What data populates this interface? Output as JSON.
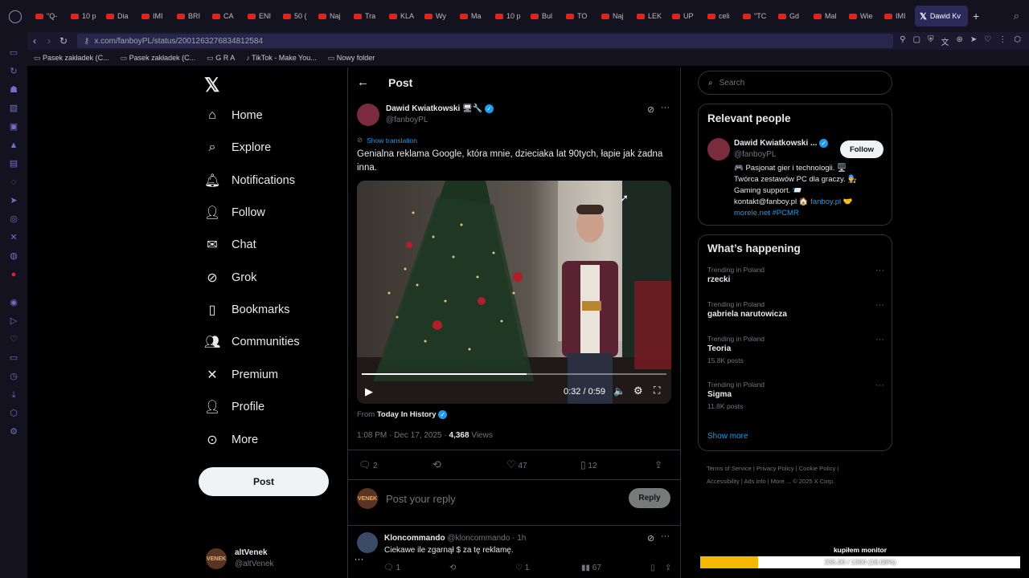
{
  "browser": {
    "tabs": [
      {
        "label": "\"Q-"
      },
      {
        "label": "10 p"
      },
      {
        "label": "Dia"
      },
      {
        "label": "IMI"
      },
      {
        "label": "BRI"
      },
      {
        "label": "CA"
      },
      {
        "label": "ENI"
      },
      {
        "label": "50 ("
      },
      {
        "label": "Naj"
      },
      {
        "label": "Tra"
      },
      {
        "label": "KLA"
      },
      {
        "label": "Wy"
      },
      {
        "label": "Ma"
      },
      {
        "label": "10 p"
      },
      {
        "label": "Bul"
      },
      {
        "label": "TO"
      },
      {
        "label": "Naj"
      },
      {
        "label": "LEK"
      },
      {
        "label": "UP"
      },
      {
        "label": "celi"
      },
      {
        "label": "\"TC"
      },
      {
        "label": "Gd"
      },
      {
        "label": "Mal"
      },
      {
        "label": "Wie"
      },
      {
        "label": "IMI"
      }
    ],
    "active_tab": "Dawid Kv",
    "url": "x.com/fanboyPL/status/2001263276834812584",
    "bookmarks": [
      "Pasek zakładek (C...",
      "Pasek zakładek (C...",
      "G R A",
      "TikTok - Make You...",
      "Nowy folder"
    ]
  },
  "nav": {
    "items": [
      {
        "label": "Home",
        "icon": "home-icon"
      },
      {
        "label": "Explore",
        "icon": "search-icon"
      },
      {
        "label": "Notifications",
        "icon": "bell-icon"
      },
      {
        "label": "Follow",
        "icon": "person-add-icon"
      },
      {
        "label": "Chat",
        "icon": "mail-icon"
      },
      {
        "label": "Grok",
        "icon": "grok-icon"
      },
      {
        "label": "Bookmarks",
        "icon": "bookmark-icon"
      },
      {
        "label": "Communities",
        "icon": "people-icon"
      },
      {
        "label": "Premium",
        "icon": "x-icon"
      },
      {
        "label": "Profile",
        "icon": "person-icon"
      },
      {
        "label": "More",
        "icon": "more-circle-icon"
      }
    ],
    "post_button": "Post",
    "account": {
      "name": "altVenek",
      "handle": "@altVenek"
    }
  },
  "post": {
    "header": "Post",
    "author_name": "Dawid Kwiatkowski",
    "author_handle": "@fanboyPL",
    "show_translation": "Show translation",
    "text": "Genialna reklama Google, która mnie, dzieciaka lat 90tych, łapie jak żadna inna.",
    "video_time": "0:32 / 0:59",
    "video_progress": 0.54,
    "from_prefix": "From",
    "from_source": "Today In History",
    "timestamp": "1:08 PM · Dec 17, 2025 · ",
    "views_count": "4,368",
    "views_label": " Views",
    "replies": "2",
    "likes": "47",
    "bookmarks": "12",
    "reply_placeholder": "Post your reply",
    "reply_button": "Reply"
  },
  "reply": {
    "author_name": "Kloncommando",
    "author_handle": "@kloncommando · 1h",
    "text": "Ciekawe ile zgarnął $ za tę reklamę.",
    "replies": "1",
    "likes": "1",
    "views": "67"
  },
  "right": {
    "search_placeholder": "Search",
    "relevant_title": "Relevant people",
    "person_name": "Dawid Kwiatkowski ...",
    "person_handle": "@fanboyPL",
    "follow_button": "Follow",
    "bio_1": "🎮 Pasjonat gier i technologii. 🖥️",
    "bio_2": "Twórca zestawów PC dla graczy. 👨‍🔧",
    "bio_3": "Gaming support. 📨",
    "bio_4a": "kontakt@fanboy.pl 🏠 ",
    "bio_4b": "fanboy.pl",
    "bio_4c": " 🤝",
    "bio_5": "morele.net #PCMR",
    "happening_title": "What’s happening",
    "trends": [
      {
        "meta": "Trending in Poland",
        "name": "rzecki",
        "posts": ""
      },
      {
        "meta": "Trending in Poland",
        "name": "gabriela narutowicza",
        "posts": ""
      },
      {
        "meta": "Trending in Poland",
        "name": "Teoria",
        "posts": "15.8K posts"
      },
      {
        "meta": "Trending in Poland",
        "name": "Sigma",
        "posts": "11.8K posts"
      }
    ],
    "show_more": "Show more",
    "footer_line1": "Terms of Service  |  Privacy Policy  |  Cookie Policy  |",
    "footer_line2": "Accessibility  |  Ads info  |  More ...  © 2025 X Corp."
  },
  "donation": {
    "title": "kupiłem monitor",
    "progress_text": "235.00 / 1300 (18.08%)",
    "progress": 0.1808
  },
  "colors": {
    "accent": "#1d9bf0",
    "donation_fill": "#f5b800"
  }
}
